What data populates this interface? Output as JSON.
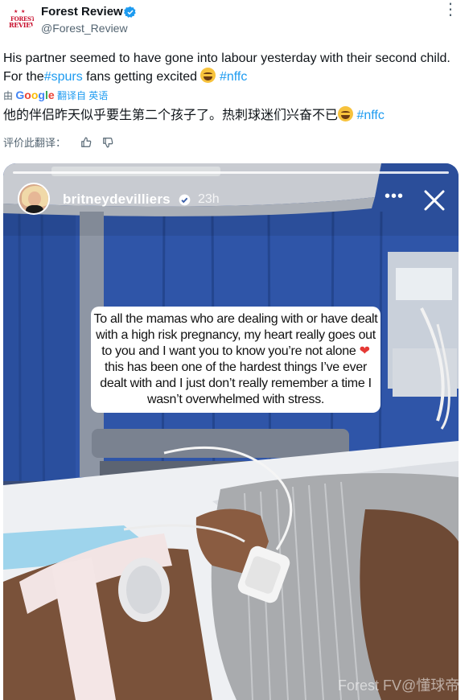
{
  "tweet": {
    "author_name": "Forest Review",
    "author_handle": "@Forest_Review",
    "avatar_logo": {
      "line1": "FOREST",
      "line2": "REVIEW"
    },
    "text_part1": "His partner seemed to have gone into labour yesterday with their second child. For the",
    "text_hashtag1": "#spurs",
    "text_part2": " fans getting excited ",
    "text_hashtag2": "#nffc",
    "translate_prefix": "由",
    "translate_suffix": "翻译自 英语",
    "translated_text": "他的伴侣昨天似乎要生第二个孩子了。热刺球迷们兴奋不已",
    "translated_hashtag": "#nffc",
    "rate_label": "评价此翻译：",
    "more_icon": "more-horizontal-icon",
    "colors": {
      "link": "#1d9bf0",
      "verified": "#1d9bf0",
      "secondary": "#536471"
    }
  },
  "story": {
    "username": "britneydevilliers",
    "time": "23h",
    "caption_lines": [
      "To all the mamas who are dealing with or have dealt",
      "with a high risk pregnancy, my heart really goes out",
      "to you and I want you to know you’re not alone",
      "this has been one of the hardest things I’ve ever",
      "dealt with and I just don’t really remember a time I",
      "wasn’t overwhelmed with stress."
    ]
  },
  "watermark": "Forest FV@懂球帝"
}
